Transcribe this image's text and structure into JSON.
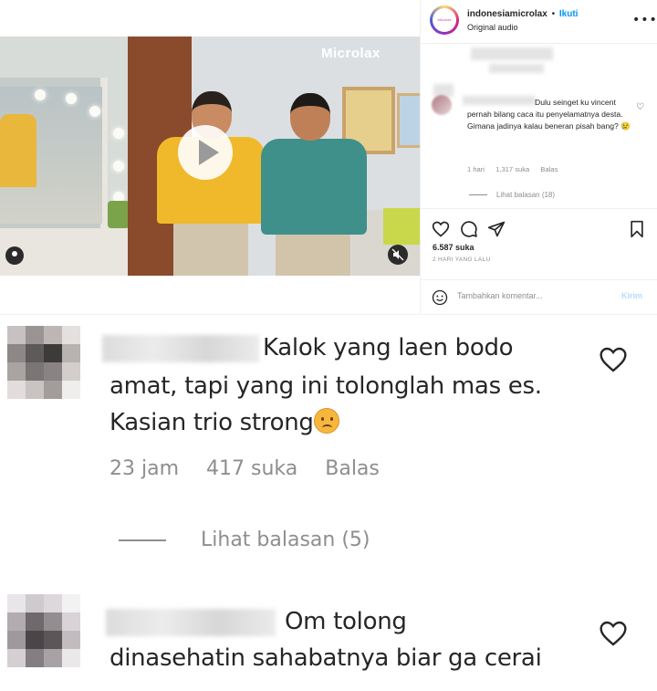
{
  "post": {
    "video": {
      "brand_watermark": "Microlax"
    },
    "header": {
      "account_name": "indonesiamicrolax",
      "separator": "•",
      "follow_label": "Ikuti",
      "audio_label": "Original audio",
      "avatar_text": "Microlax"
    },
    "comment": {
      "text": "Dulu seinget ku vincent pernah bilang caca itu penyelamatnya desta. Gimana jadinya kalau beneran pisah bang? 😢",
      "time": "1 hari",
      "likes": "1,317 suka",
      "reply_label": "Balas",
      "view_replies": "Lihat balasan (18)"
    },
    "actions": {
      "likes_count": "6.587 suka",
      "date": "2 HARI YANG LALU"
    },
    "add_comment": {
      "placeholder": "Tambahkan komentar...",
      "send_label": "Kirim"
    }
  },
  "zoomed_comments": [
    {
      "line1": "Kalok yang laen bodo",
      "line2": "amat, tapi yang ini tolonglah mas es.",
      "line3": "Kasian trio strong",
      "time": "23 jam",
      "likes": "417 suka",
      "reply_label": "Balas",
      "view_replies": "Lihat balasan (5)"
    },
    {
      "line1": "Om tolong",
      "line2": "dinasehatin sahabatnya biar ga cerai"
    }
  ],
  "colors": {
    "link_blue": "#0095f6",
    "muted_text": "#8e8e8e",
    "primary_text": "#262626",
    "send_disabled": "#b3dbff"
  },
  "icons": [
    "play-icon",
    "user-tag-icon",
    "mute-icon",
    "more-icon",
    "heart-icon",
    "comment-icon",
    "share-icon",
    "bookmark-icon",
    "emoji-icon",
    "sad-emoji-icon"
  ]
}
